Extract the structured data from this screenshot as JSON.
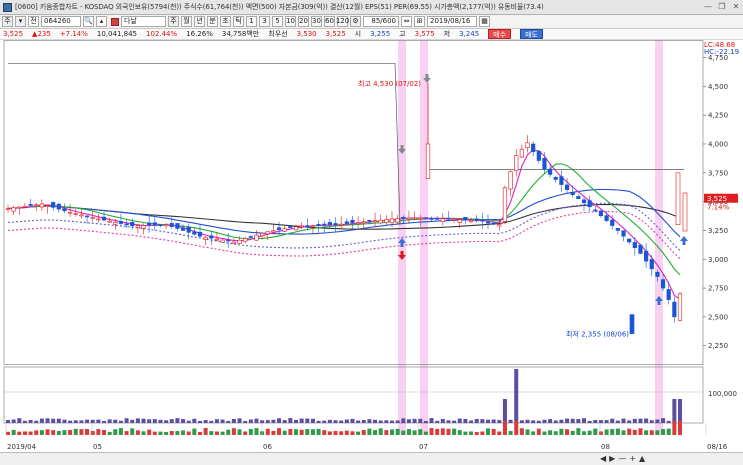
{
  "window": {
    "title": "[0600] 키움종합차트 - KOSDAQ 외국인보유(5794(천)) 주식수(61,764(천)) 액면(500) 자본금(309(억)) 결산(12월) EPS(51) PER(69.55) 시가총액(2,177(억)) 유동비율(73.4)",
    "min_label": "—",
    "restore_label": "❐",
    "close_label": "✕"
  },
  "toolbar": {
    "main_label": "주",
    "arrow_label": "▾",
    "prev_label": "전",
    "code": "064260",
    "search_icon": "🔍",
    "code_arrow": "▴",
    "name": "다날",
    "chart_period": "주",
    "periods": [
      "월",
      "년",
      "분",
      "초",
      "틱",
      "1",
      "3",
      "5",
      "10",
      "20",
      "30",
      "60",
      "120"
    ],
    "page_value": "85/600",
    "date": "2019/08/16"
  },
  "info": {
    "price": "3,525",
    "change": "235",
    "change_pct": "+7.14%",
    "volume": "10,041,845",
    "volume_pct": "102.44%",
    "turnover": "16.26%",
    "amount": "34,758백만",
    "priority_sell_label": "최우선",
    "priority_sell": "3,530",
    "priority_buy": "3,525",
    "open_label": "시",
    "open": "3,255",
    "high_label": "고",
    "high": "3,575",
    "low_label": "저",
    "low": "3,245",
    "buy_label": "매수",
    "sell_label": "매도"
  },
  "chart_data": {
    "type": "candlestick",
    "price_axis": [
      "4,750",
      "4,500",
      "4,250",
      "4,000",
      "3,750",
      "3,500",
      "3,250",
      "3,000",
      "2,750",
      "2,500",
      "2,250"
    ],
    "ylim": [
      2100,
      4850
    ],
    "current_price_tag": "3,525",
    "current_pct_tag": "7.14%",
    "lc_label": "LC:48.68",
    "hc_label": "HC:-22.19",
    "high_annotation": "최고 4,530 (07/02)",
    "low_annotation": "최저 2,355 (08/06)",
    "volume_axis_label": "100,000",
    "x_labels": [
      "2019/04",
      "05",
      "06",
      "07",
      "08",
      "08/16"
    ],
    "series_colors": {
      "ma5": "#e020c0",
      "ma20": "#20b030",
      "ma60": "#2050d0",
      "ma120": "#333333",
      "envelope": "#6060d0",
      "envelope_lower": "#e040a0"
    },
    "signal_markers": [
      "up",
      "down",
      "up",
      "up"
    ]
  },
  "bottom": {
    "ctrl1": "◀",
    "ctrl2": "▶",
    "ctrl3": "—",
    "ctrl4": "+",
    "ctrl5": "▲"
  }
}
